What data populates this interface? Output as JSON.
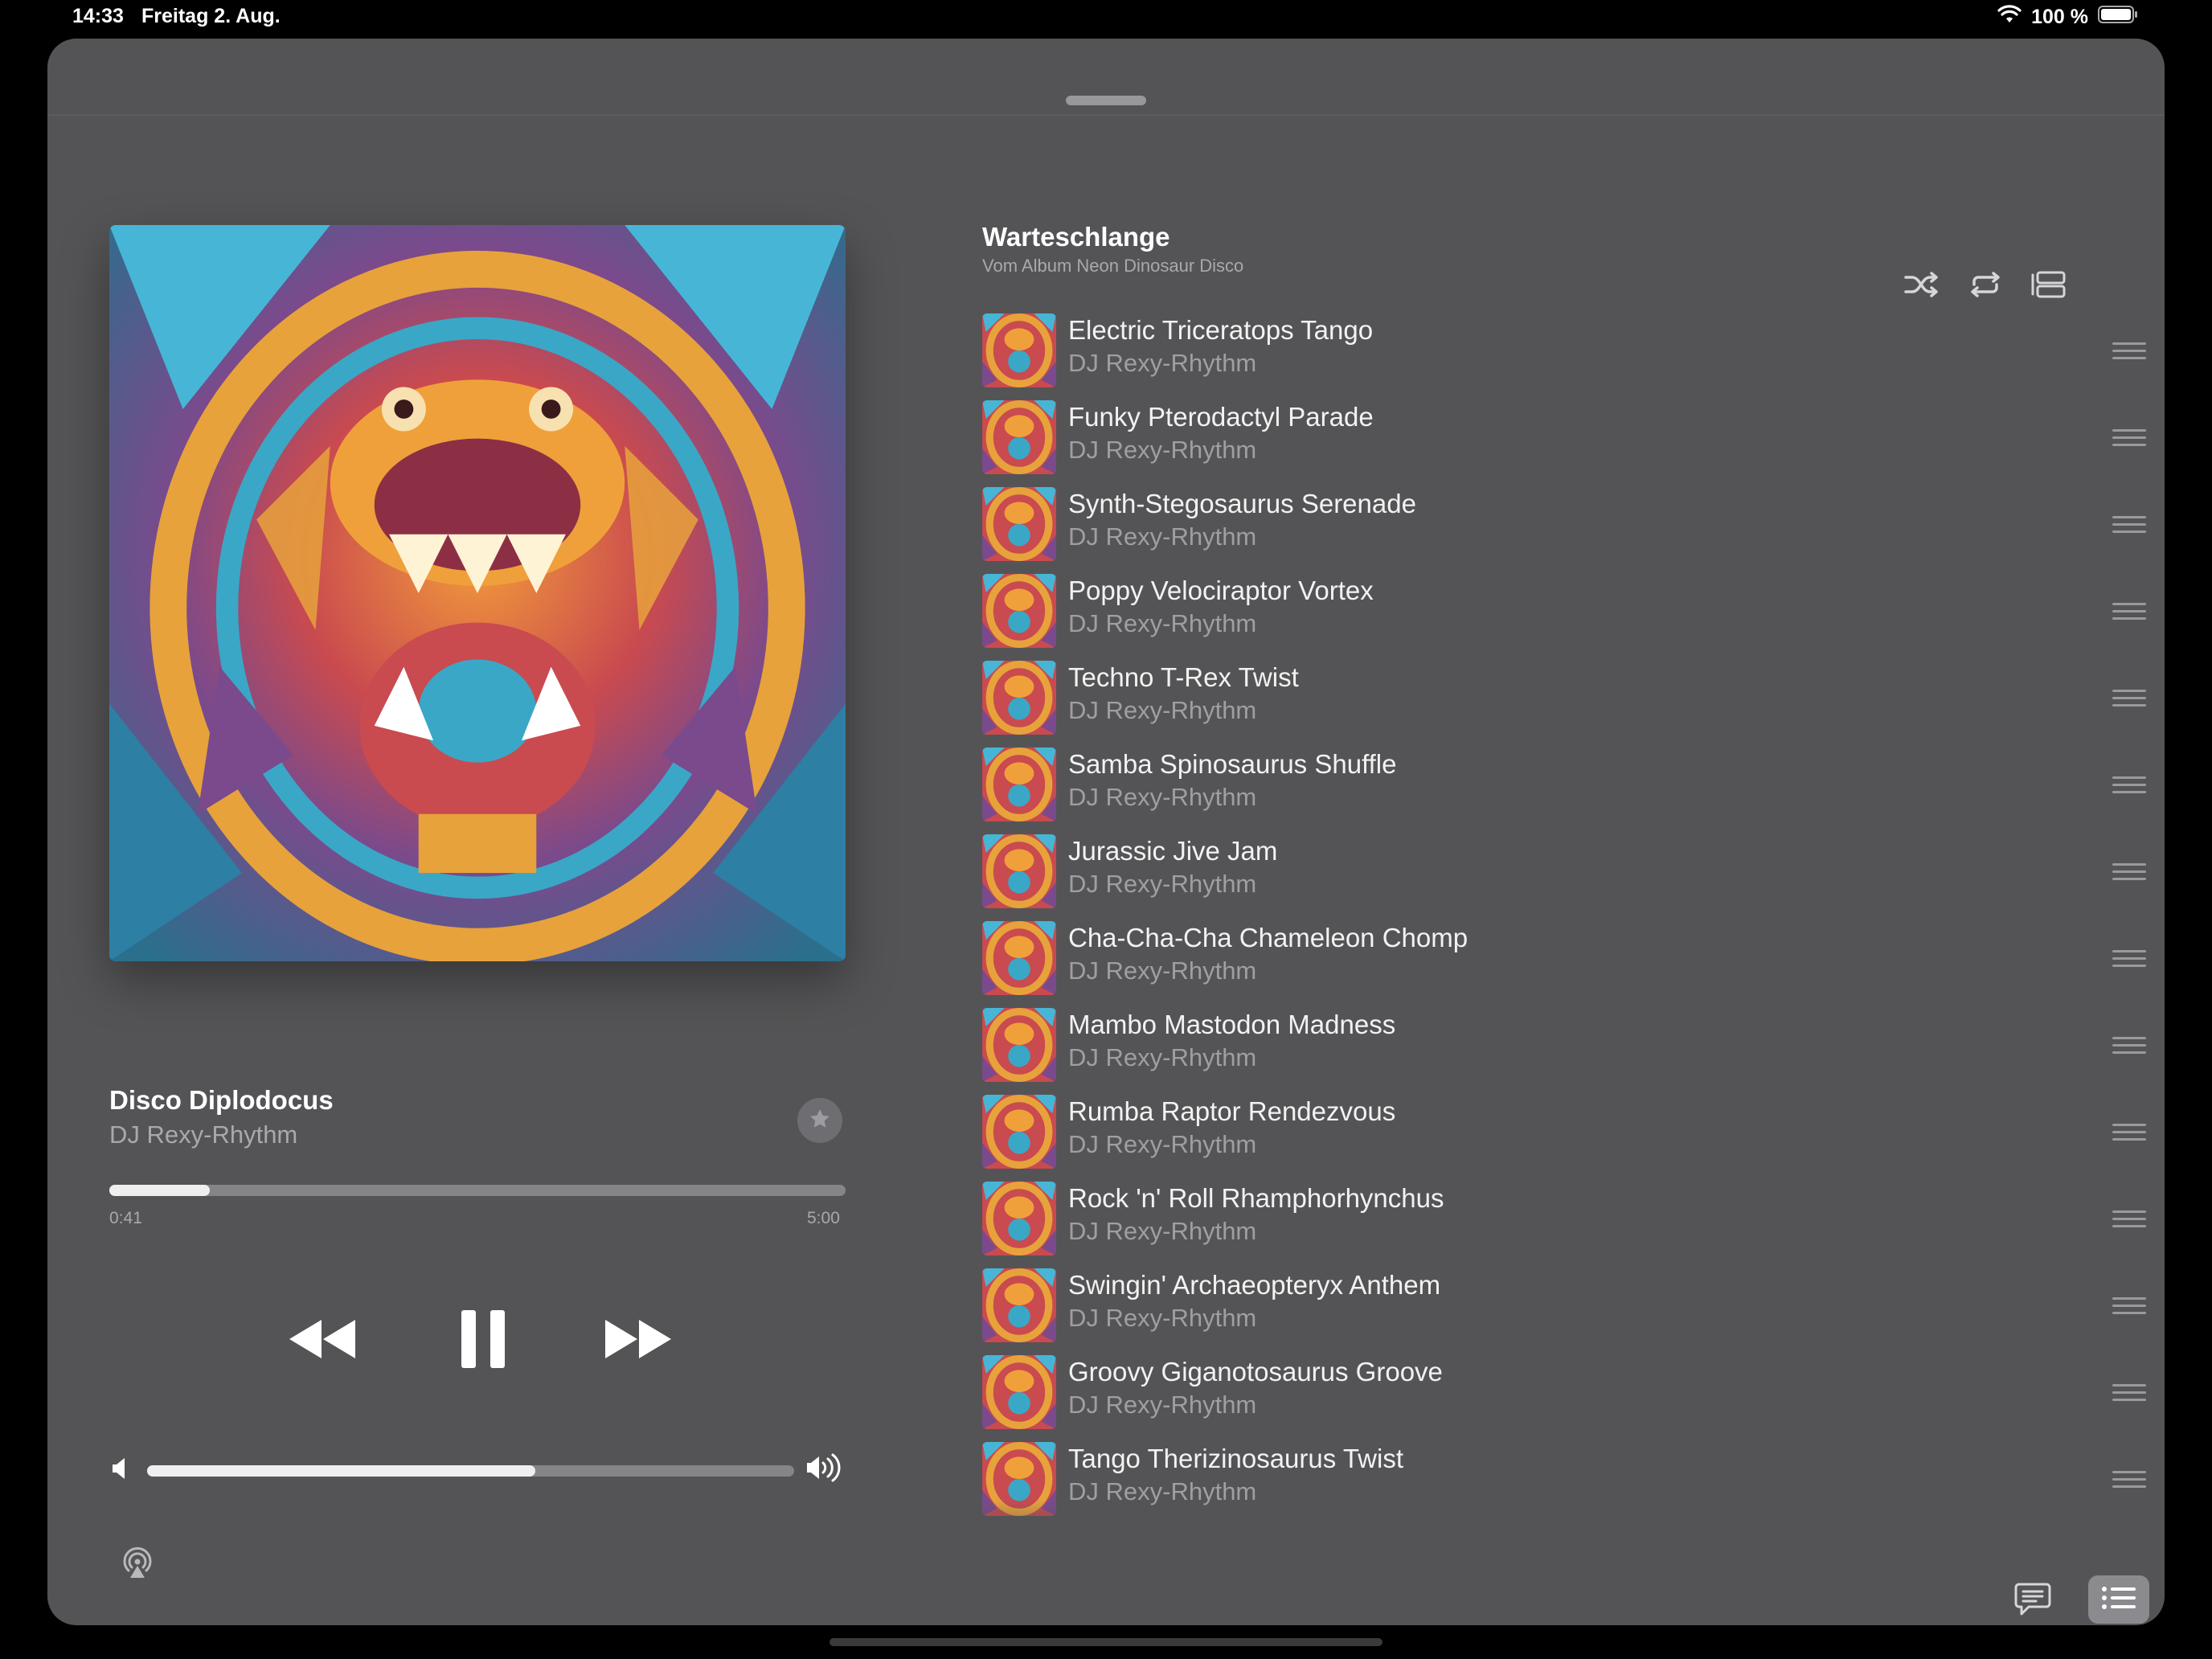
{
  "status": {
    "time": "14:33",
    "date": "Freitag 2. Aug.",
    "battery": "100 %",
    "icons": [
      "wifi-icon",
      "battery-icon"
    ]
  },
  "now_playing": {
    "title": "Disco Diplodocus",
    "artist": "DJ Rexy-Rhythm",
    "elapsed": "0:41",
    "total": "5:00",
    "progress_fraction": 0.137,
    "volume_fraction": 0.6,
    "icons": [
      "star-icon",
      "rewind-icon",
      "pause-icon",
      "fast-forward-icon",
      "speaker-low-icon",
      "speaker-high-icon"
    ]
  },
  "queue": {
    "title": "Warteschlange",
    "subtitle": "Vom Album Neon Dinosaur Disco",
    "icons": [
      "shuffle-icon",
      "repeat-icon",
      "autoplay-icon"
    ],
    "items": [
      {
        "title": "Electric Triceratops Tango",
        "artist": "DJ Rexy-Rhythm"
      },
      {
        "title": "Funky Pterodactyl Parade",
        "artist": "DJ Rexy-Rhythm"
      },
      {
        "title": "Synth-Stegosaurus Serenade",
        "artist": "DJ Rexy-Rhythm"
      },
      {
        "title": "Poppy Velociraptor Vortex",
        "artist": "DJ Rexy-Rhythm"
      },
      {
        "title": "Techno T-Rex Twist",
        "artist": "DJ Rexy-Rhythm"
      },
      {
        "title": "Samba Spinosaurus Shuffle",
        "artist": "DJ Rexy-Rhythm"
      },
      {
        "title": "Jurassic Jive Jam",
        "artist": "DJ Rexy-Rhythm"
      },
      {
        "title": "Cha-Cha-Cha Chameleon Chomp",
        "artist": "DJ Rexy-Rhythm"
      },
      {
        "title": "Mambo Mastodon Madness",
        "artist": "DJ Rexy-Rhythm"
      },
      {
        "title": "Rumba Raptor Rendezvous",
        "artist": "DJ Rexy-Rhythm"
      },
      {
        "title": "Rock 'n' Roll Rhamphorhynchus",
        "artist": "DJ Rexy-Rhythm"
      },
      {
        "title": "Swingin' Archaeopteryx Anthem",
        "artist": "DJ Rexy-Rhythm"
      },
      {
        "title": "Groovy Giganotosaurus Groove",
        "artist": "DJ Rexy-Rhythm"
      },
      {
        "title": "Tango Therizinosaurus Twist",
        "artist": "DJ Rexy-Rhythm"
      }
    ]
  },
  "bottom_bar": {
    "icons": [
      "airplay-icon",
      "lyrics-icon",
      "queue-list-icon"
    ]
  },
  "colors": {
    "sheet_background": "#545456",
    "primary_text": "#ffffff",
    "secondary_text": "#a9a9ad",
    "track_fill": "#efefef",
    "track_empty": "#858589"
  }
}
